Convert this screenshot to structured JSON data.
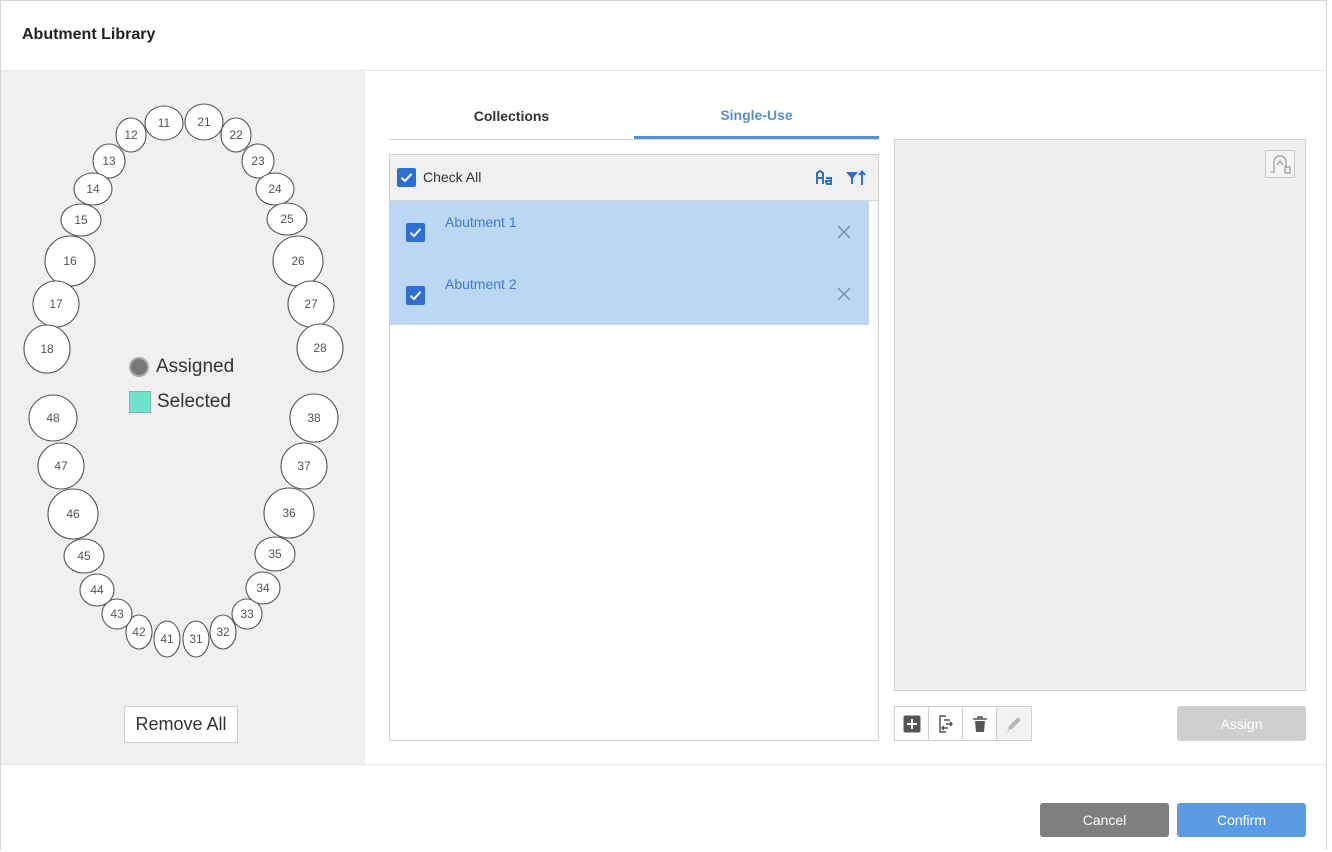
{
  "dialog": {
    "title": "Abutment Library"
  },
  "tooth_chart": {
    "teeth": [
      "11",
      "12",
      "13",
      "14",
      "15",
      "16",
      "17",
      "18",
      "21",
      "22",
      "23",
      "24",
      "25",
      "26",
      "27",
      "28",
      "31",
      "32",
      "33",
      "34",
      "35",
      "36",
      "37",
      "38",
      "41",
      "42",
      "43",
      "44",
      "45",
      "46",
      "47",
      "48"
    ],
    "legend": {
      "assigned_label": "Assigned",
      "selected_label": "Selected",
      "assigned_color": "#777777",
      "selected_color": "#6ee3cc"
    },
    "remove_all_label": "Remove All"
  },
  "tabs": [
    {
      "label": "Collections",
      "active": false
    },
    {
      "label": "Single-Use",
      "active": true
    }
  ],
  "list": {
    "check_all_label": "Check All",
    "check_all_checked": true,
    "header_icons": [
      "sort-alpha-icon",
      "sort-filter-icon"
    ],
    "items": [
      {
        "label": "Abutment 1",
        "checked": true
      },
      {
        "label": "Abutment 2",
        "checked": true
      }
    ]
  },
  "preview": {
    "icon": "tooth-view-icon"
  },
  "toolbar": {
    "icons": [
      "add-icon",
      "import-icon",
      "delete-icon",
      "edit-icon"
    ],
    "assign_label": "Assign"
  },
  "footer": {
    "cancel_label": "Cancel",
    "confirm_label": "Confirm"
  },
  "colors": {
    "accent": "#5b9be6",
    "checkbox": "#2f6fd1",
    "row_selected": "#bcd7f3"
  }
}
